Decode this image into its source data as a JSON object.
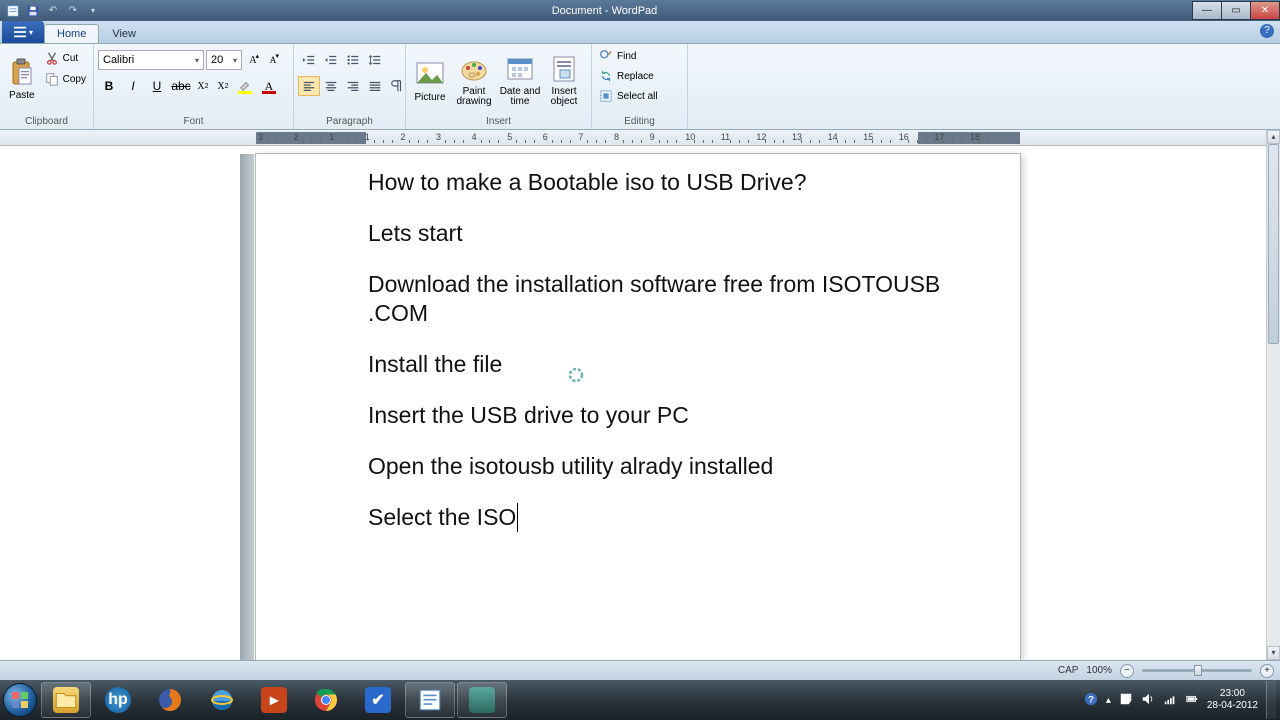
{
  "window": {
    "title": "Document - WordPad"
  },
  "tabs": {
    "home": "Home",
    "view": "View"
  },
  "clipboard": {
    "paste": "Paste",
    "cut": "Cut",
    "copy": "Copy",
    "label": "Clipboard"
  },
  "font": {
    "family": "Calibri",
    "size": "20",
    "label": "Font"
  },
  "paragraph": {
    "label": "Paragraph"
  },
  "insert": {
    "picture": "Picture",
    "paint": "Paint drawing",
    "datetime": "Date and time",
    "object": "Insert object",
    "label": "Insert"
  },
  "editing": {
    "find": "Find",
    "replace": "Replace",
    "selectall": "Select all",
    "label": "Editing"
  },
  "ruler_marks": [
    "3",
    "2",
    "1",
    "1",
    "2",
    "3",
    "4",
    "5",
    "6",
    "7",
    "8",
    "9",
    "10",
    "11",
    "12",
    "13",
    "14",
    "15",
    "16",
    "17",
    "18"
  ],
  "document": {
    "p1": "How to make a Bootable iso to USB Drive?",
    "p2": "Lets start",
    "p3": "Download the installation software free from ISOTOUSB .COM",
    "p4": "Install the file",
    "p5": "Insert the USB drive to your PC",
    "p6": "Open the isotousb utility alrady installed",
    "p7": "Select the ISO"
  },
  "status": {
    "cap": "CAP",
    "zoom": "100%"
  },
  "tray": {
    "time": "23:00",
    "date": "28-04-2012"
  }
}
